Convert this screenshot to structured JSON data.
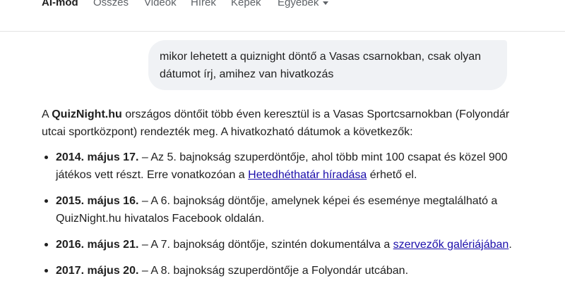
{
  "tabs": {
    "ai_mode": "AI-mód",
    "all": "Összes",
    "videos": "Videók",
    "news": "Hírek",
    "images": "Képek",
    "more": "Egyebek"
  },
  "query": {
    "text": "mikor lehetett a quiznight döntő a Vasas csarnokban, csak olyan dátumot írj, amihez van hivatkozás"
  },
  "answer": {
    "intro_pre": "A ",
    "intro_brand": "QuizNight.hu",
    "intro_post": " országos döntőit több éven keresztül is a Vasas Sportcsarnokban (Folyondár utcai sportközpont) rendezték meg. A hivatkozható dátumok a következők:",
    "items": [
      {
        "date": "2014. május 17.",
        "text_pre": " – Az 5. bajnokság szuperdöntője, ahol több mint 100 csapat és közel 900 játékos vett részt. Erre vonatkozóan a ",
        "link": "Hetedhéthatár híradása",
        "text_post": " érhető el."
      },
      {
        "date": "2015. május 16.",
        "text_pre": " – A 6. bajnokság döntője, amelynek képei és eseménye megtalálható a QuizNight.hu hivatalos Facebook oldalán."
      },
      {
        "date": "2016. május 21.",
        "text_pre": " – A 7. bajnokság döntője, szintén dokumentálva a ",
        "link": "szervezők galériájában",
        "text_post": "."
      },
      {
        "date": "2017. május 20.",
        "text_pre": " – A 8. bajnokság szuperdöntője a Folyondár utcában."
      }
    ]
  }
}
